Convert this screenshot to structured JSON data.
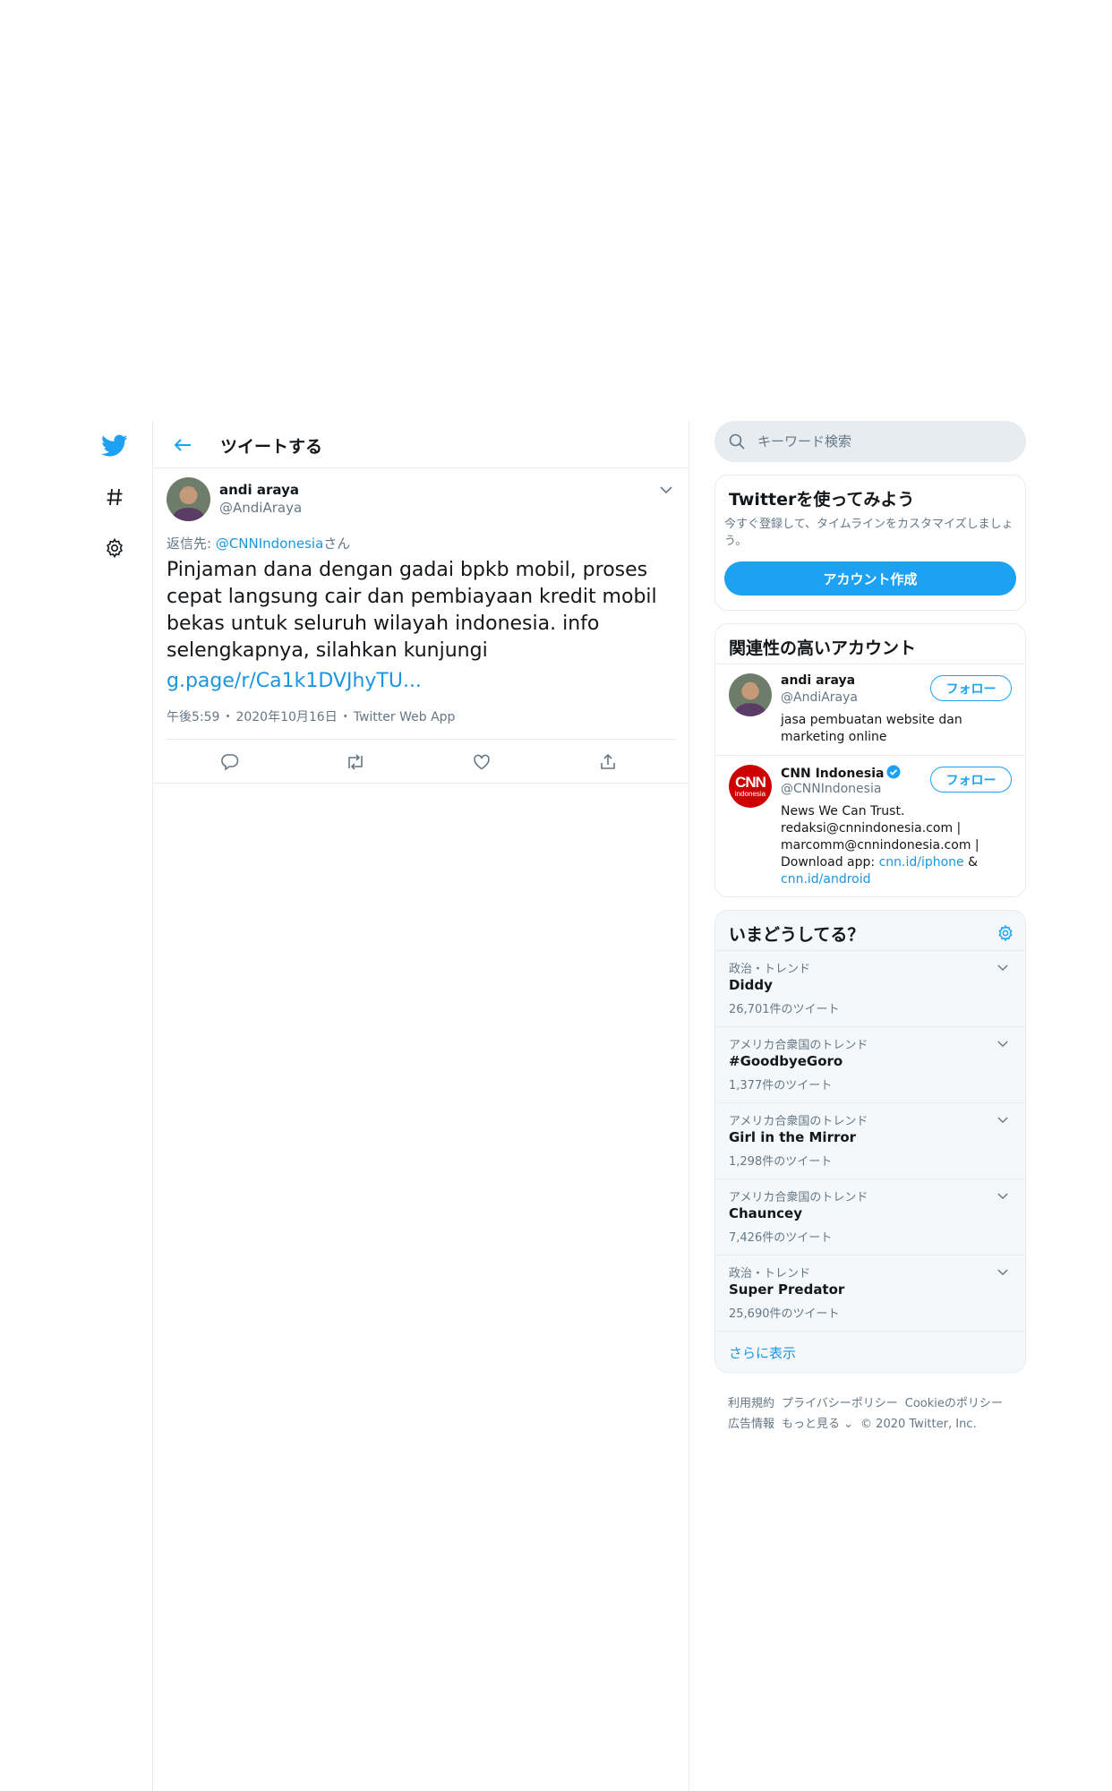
{
  "header": {
    "title": "ツイートする"
  },
  "tweet": {
    "author_name": "andi araya",
    "author_handle": "@AndiAraya",
    "reply_prefix": "返信先: ",
    "reply_mention": "@CNNIndonesia",
    "reply_suffix": "さん",
    "text": "Pinjaman dana dengan gadai bpkb mobil, proses cepat langsung cair dan pembiayaan kredit mobil bekas untuk seluruh wilayah indonesia. info selengkapnya, silahkan kunjungi",
    "link": "g.page/r/Ca1k1DVJhyTU...",
    "time": "午後5:59",
    "date": "2020年10月16日",
    "source": "Twitter Web App",
    "separator": "・"
  },
  "search": {
    "placeholder": "キーワード検索"
  },
  "signup": {
    "title": "Twitterを使ってみよう",
    "description": "今すぐ登録して、タイムラインをカスタマイズしましょう。",
    "button_label": "アカウント作成"
  },
  "relevant": {
    "title": "関連性の高いアカウント",
    "users": [
      {
        "name": "andi araya",
        "handle": "@AndiAraya",
        "bio": "jasa pembuatan website dan marketing online",
        "follow_label": "フォロー"
      },
      {
        "name": "CNN Indonesia",
        "handle": "@CNNIndonesia",
        "bio_text": "News We Can Trust. redaksi@cnnindonesia.com | marcomm@cnnindonesia.com | Download app: ",
        "bio_link1": "cnn.id/iphone",
        "bio_amp": " & ",
        "bio_link2": "cnn.id/android",
        "follow_label": "フォロー",
        "logo_big": "CNN",
        "logo_small": "indonesia"
      }
    ]
  },
  "trends": {
    "title": "いまどうしてる？",
    "items": [
      {
        "category": "政治・トレンド",
        "name": "Diddy",
        "count": "26,701件のツイート"
      },
      {
        "category": "アメリカ合衆国のトレンド",
        "name": "#GoodbyeGoro",
        "count": "1,377件のツイート"
      },
      {
        "category": "アメリカ合衆国のトレンド",
        "name": "Girl in the Mirror",
        "count": "1,298件のツイート"
      },
      {
        "category": "アメリカ合衆国のトレンド",
        "name": "Chauncey",
        "count": "7,426件のツイート"
      },
      {
        "category": "政治・トレンド",
        "name": "Super Predator",
        "count": "25,690件のツイート"
      }
    ],
    "show_more": "さらに表示"
  },
  "footer": {
    "links": [
      "利用規約",
      "プライバシーポリシー",
      "Cookieのポリシー",
      "広告情報",
      "もっと見る ⌄"
    ],
    "copyright": "© 2020 Twitter, Inc."
  },
  "colors": {
    "accent": "#1da1f2",
    "link": "#1b95e0",
    "muted": "#657786",
    "border": "#e6ecf0"
  }
}
